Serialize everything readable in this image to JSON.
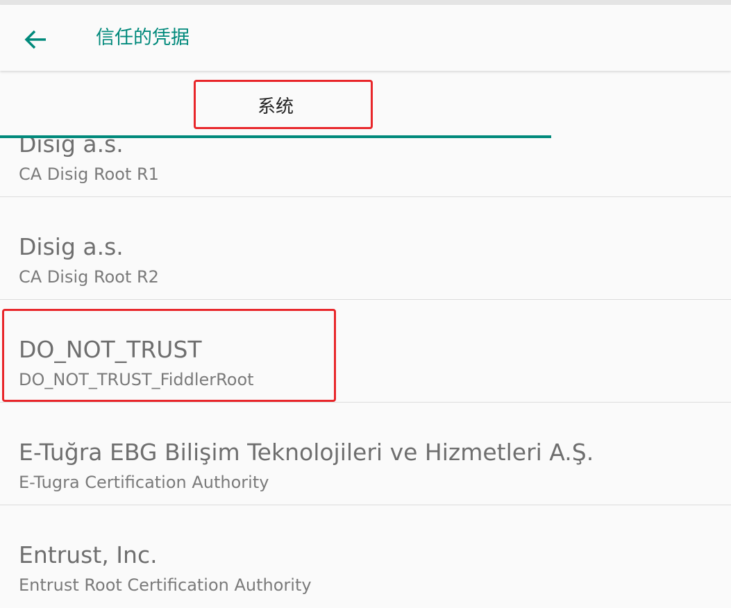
{
  "header": {
    "title": "信任的凭据",
    "back_icon": "arrow-left-icon"
  },
  "tabs": [
    {
      "label": "系统",
      "selected": true
    }
  ],
  "colors": {
    "accent": "#00897b",
    "highlight": "#e8262a"
  },
  "certificates": [
    {
      "title": "Disig a.s.",
      "subtitle": "CA Disig Root R1"
    },
    {
      "title": "Disig a.s.",
      "subtitle": "CA Disig Root R2"
    },
    {
      "title": "DO_NOT_TRUST",
      "subtitle": "DO_NOT_TRUST_FiddlerRoot"
    },
    {
      "title": "E-Tuğra EBG Bilişim Teknolojileri ve Hizmetleri A.Ş.",
      "subtitle": "E-Tugra Certification Authority"
    },
    {
      "title": "Entrust, Inc.",
      "subtitle": "Entrust Root Certification Authority"
    }
  ]
}
